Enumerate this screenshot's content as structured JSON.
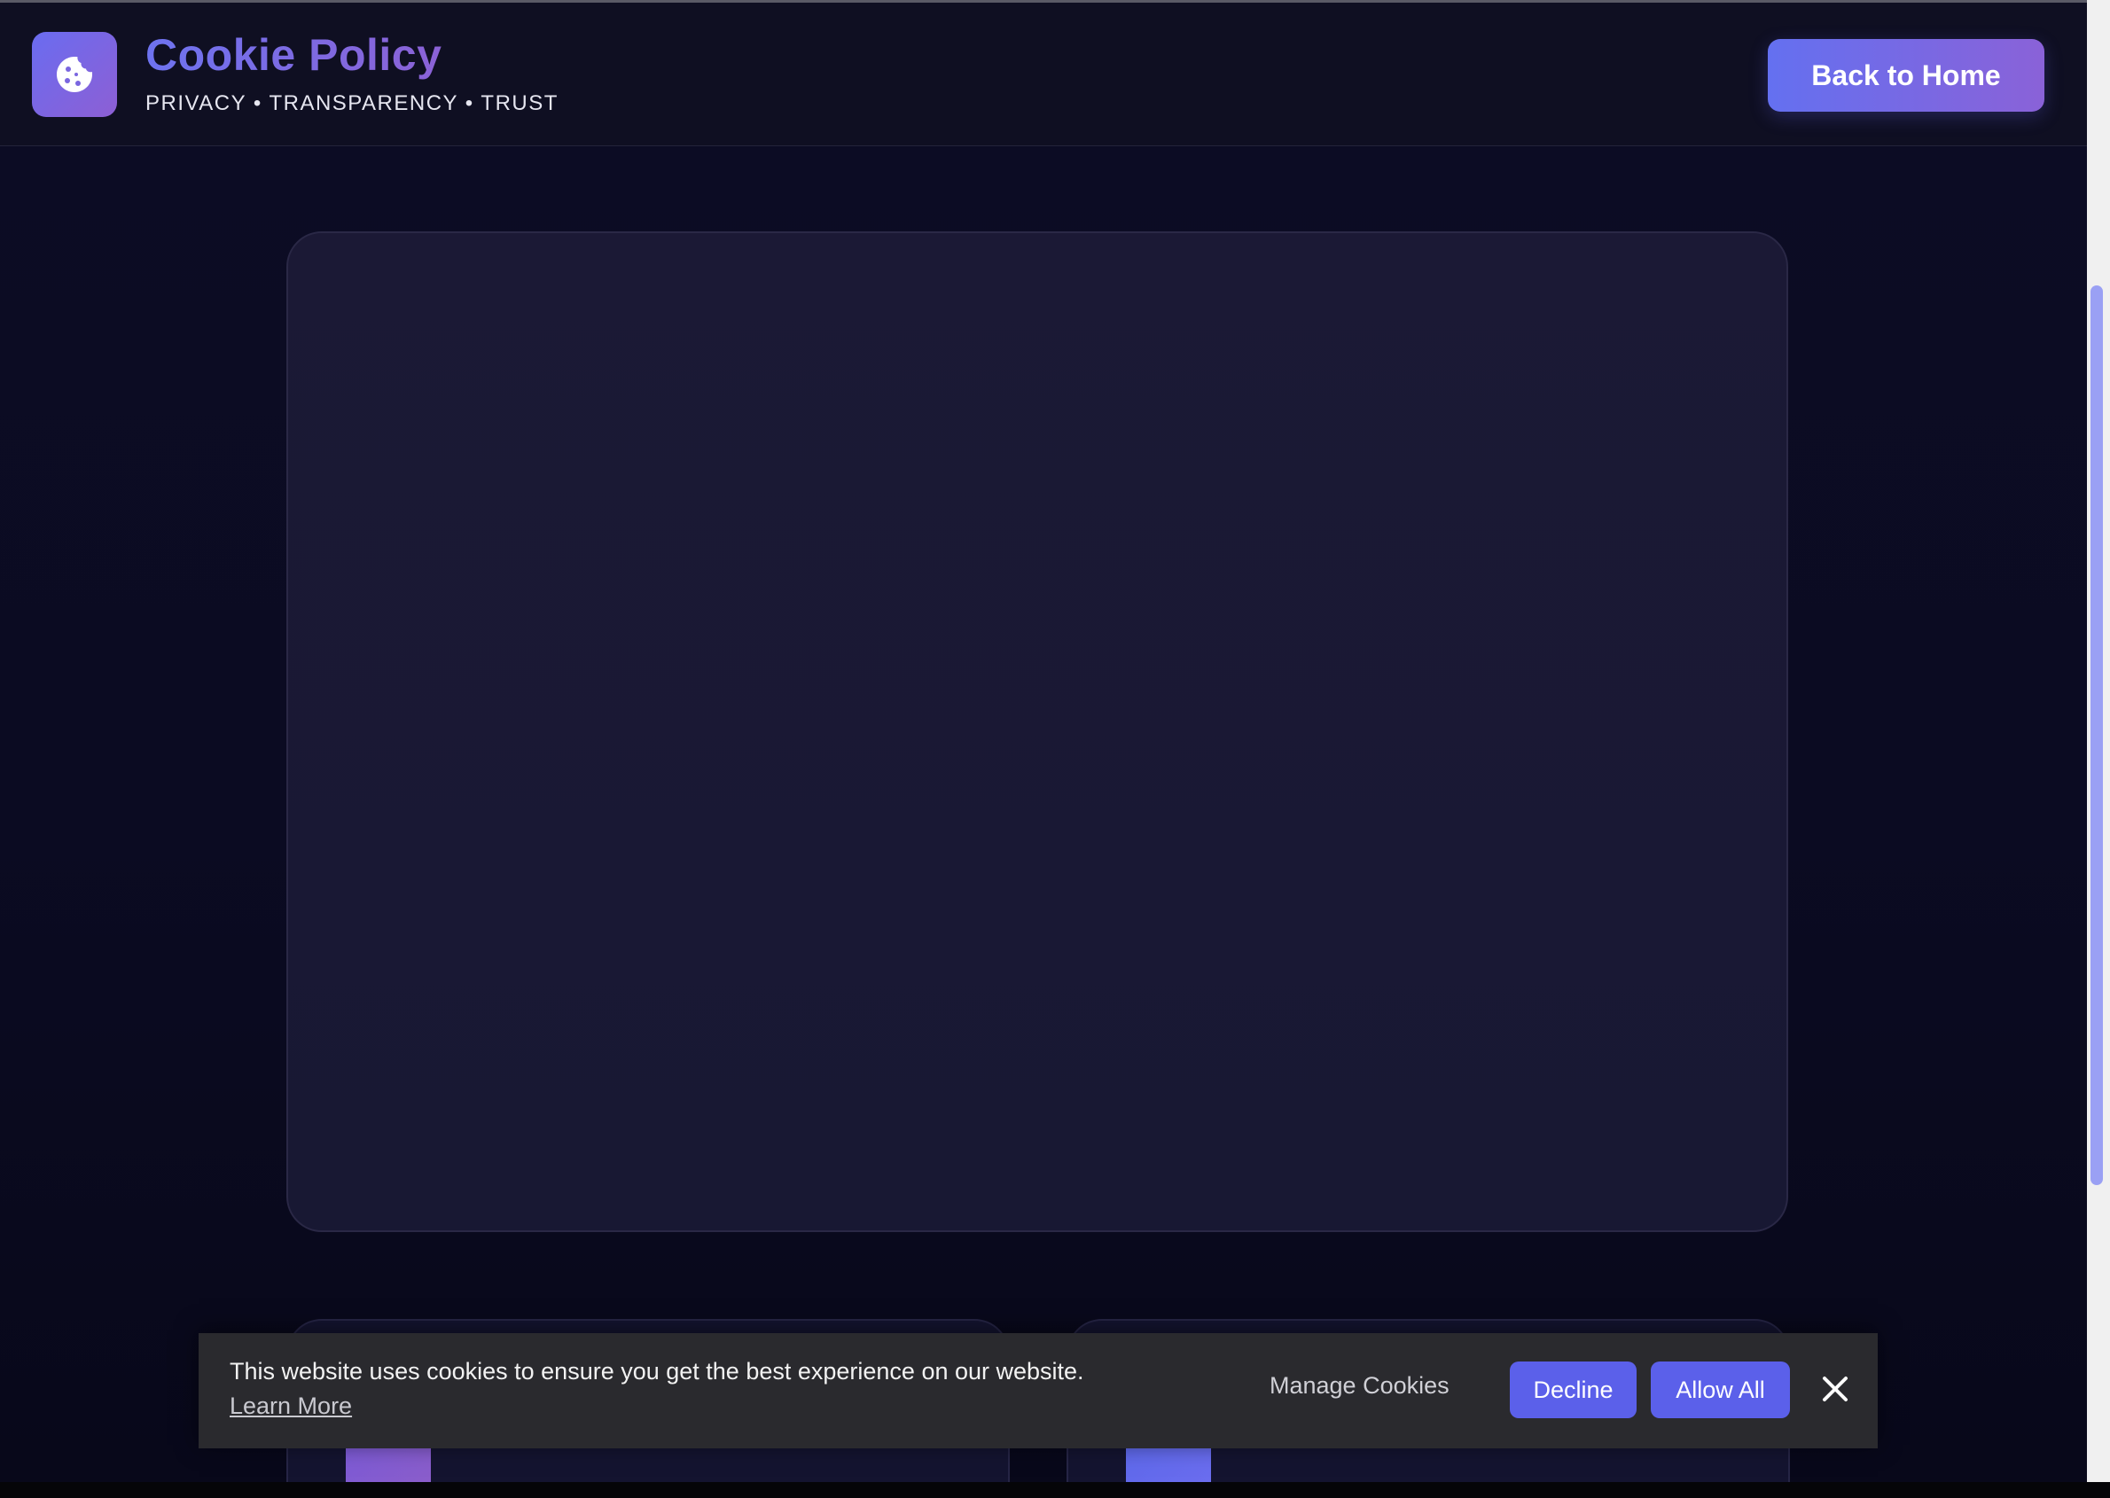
{
  "header": {
    "title": "Cookie Policy",
    "tagline": "PRIVACY • TRANSPARENCY • TRUST",
    "logo_icon": "cookie-icon",
    "home_button": "Back to Home"
  },
  "cookie_banner": {
    "message": "This website uses cookies to ensure you get the best experience on our website.",
    "learn_more": "Learn More",
    "manage": "Manage Cookies",
    "decline": "Decline",
    "allow": "Allow All",
    "close_icon": "close-icon"
  },
  "colors": {
    "background": "#0c0c24",
    "accent": "#5b60ea",
    "accent_gradient_end": "#8a62d8",
    "banner": "#2a2a2e"
  }
}
